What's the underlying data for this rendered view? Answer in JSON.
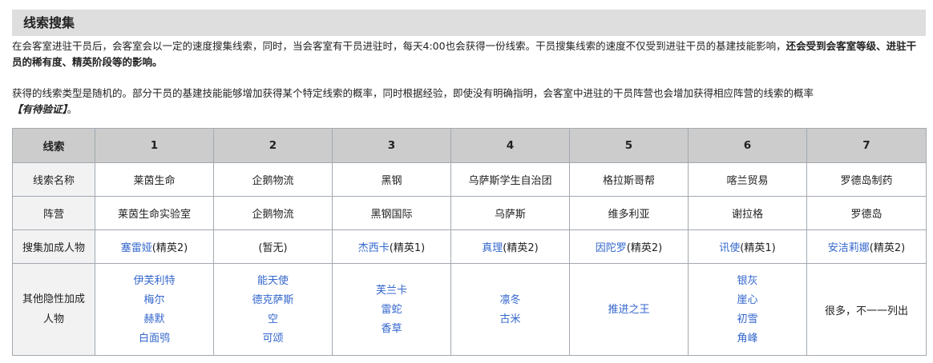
{
  "section": {
    "title": "线索搜集"
  },
  "intro": {
    "p1_text": "在会客室进驻干员后，会客室会以一定的速度搜集线索，同时，当会客室有干员进驻时，每天4:00也会获得一份线索。干员搜集线索的速度不仅受到进驻干员的基建技能影响，",
    "p1_bold": "还会受到会客室等级、进驻干员的稀有度、精英阶段等的影响。",
    "p2_text": "获得的线索类型是随机的。部分干员的基建技能能够增加获得某个特定线索的概率，同时根据经验，即使没有明确指明，会客室中进驻的干员阵营也会增加获得相应阵营的线索的概率",
    "p2_note": "【有待验证】",
    "p2_end": "。"
  },
  "table": {
    "headers": [
      "线索",
      "1",
      "2",
      "3",
      "4",
      "5",
      "6",
      "7"
    ],
    "row_labels": {
      "name": "线索名称",
      "camp": "阵营",
      "bonus": "搜集加成人物",
      "hidden_line1": "其他隐性加成",
      "hidden_line2": "人物"
    },
    "names": [
      "莱茵生命",
      "企鹅物流",
      "黑钢",
      "乌萨斯学生自治团",
      "格拉斯哥帮",
      "喀兰贸易",
      "罗德岛制药"
    ],
    "camps": [
      "莱茵生命实验室",
      "企鹅物流",
      "黑钢国际",
      "乌萨斯",
      "维多利亚",
      "谢拉格",
      "罗德岛"
    ],
    "bonus": [
      {
        "link": "塞雷娅",
        "suffix": "(精英2)"
      },
      {
        "link": "",
        "suffix": "(暂无)"
      },
      {
        "link": "杰西卡",
        "suffix": "(精英1)"
      },
      {
        "link": "真理",
        "suffix": "(精英2)"
      },
      {
        "link": "因陀罗",
        "suffix": "(精英2)"
      },
      {
        "link": "讯使",
        "suffix": "(精英1)"
      },
      {
        "link": "安洁莉娜",
        "suffix": "(精英2)"
      }
    ],
    "hidden": [
      [
        "伊芙利特",
        "梅尔",
        "赫默",
        "白面鸮"
      ],
      [
        "能天使",
        "德克萨斯",
        "空",
        "可颂"
      ],
      [
        "芙兰卡",
        "雷蛇",
        "香草"
      ],
      [
        "凛冬",
        "古米"
      ],
      [
        "推进之王"
      ],
      [
        "银灰",
        "崖心",
        "初雪",
        "角峰"
      ]
    ],
    "hidden_last_text": "很多，不一一列出"
  }
}
